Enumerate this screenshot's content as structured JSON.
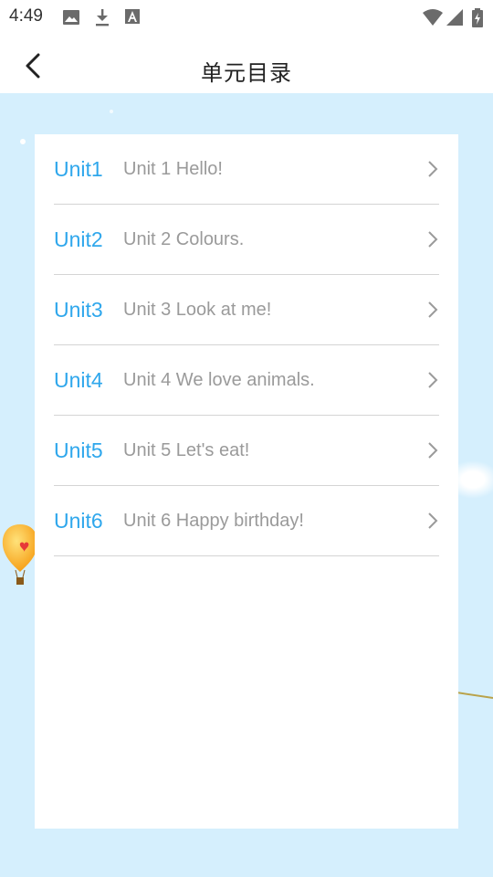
{
  "status_bar": {
    "time": "4:49",
    "left_icons": [
      "image-icon",
      "download-icon",
      "font-icon"
    ],
    "right_icons": [
      "wifi-icon",
      "signal-icon",
      "battery-charging-icon"
    ]
  },
  "header": {
    "title": "单元目录",
    "back_icon": "chevron-left-icon"
  },
  "units": [
    {
      "code": "Unit1",
      "name": "Unit 1 Hello!"
    },
    {
      "code": "Unit2",
      "name": "Unit 2 Colours."
    },
    {
      "code": "Unit3",
      "name": "Unit 3 Look at me!"
    },
    {
      "code": "Unit4",
      "name": "Unit 4 We love animals."
    },
    {
      "code": "Unit5",
      "name": "Unit 5 Let's eat!"
    },
    {
      "code": "Unit6",
      "name": "Unit 6 Happy birthday!"
    }
  ],
  "colors": {
    "accent": "#2fa7ec",
    "background": "#d5effd",
    "secondary_text": "#9a9a9a"
  }
}
